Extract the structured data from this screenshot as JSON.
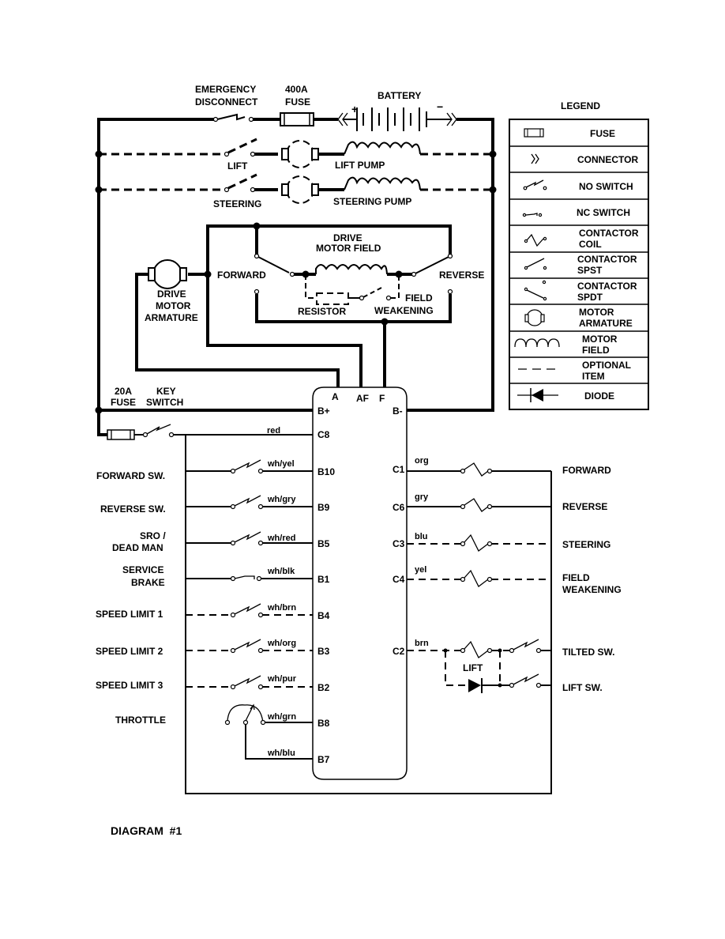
{
  "diagram": {
    "title": "DIAGRAM  #1",
    "power_circuit": {
      "emergency_disconnect": [
        "EMERGENCY",
        "DISCONNECT"
      ],
      "main_fuse": [
        "400A",
        "FUSE"
      ],
      "battery": "BATTERY",
      "battery_plus": "+",
      "battery_minus": "−",
      "lift_switch": "LIFT",
      "lift_pump": "LIFT PUMP",
      "steering_switch": "STEERING",
      "steering_pump": "STEERING PUMP",
      "drive_motor_field": [
        "DRIVE",
        "MOTOR FIELD"
      ],
      "forward": "FORWARD",
      "reverse": "REVERSE",
      "resistor": "RESISTOR",
      "field_weakening": [
        "FIELD",
        "WEAKENING"
      ],
      "drive_motor_armature": [
        "DRIVE",
        "MOTOR",
        "ARMATURE"
      ],
      "key_fuse": [
        "20A",
        "FUSE"
      ],
      "key_switch": [
        "KEY",
        "SWITCH"
      ]
    },
    "controller": {
      "top_terminals": [
        "A",
        "AF",
        "F"
      ],
      "left_pins": [
        {
          "pin": "B+",
          "wire": "",
          "label": []
        },
        {
          "pin": "C8",
          "wire": "red",
          "label": []
        },
        {
          "pin": "B10",
          "wire": "wh/yel",
          "label": [
            "FORWARD SW."
          ]
        },
        {
          "pin": "B9",
          "wire": "wh/gry",
          "label": [
            "REVERSE SW."
          ]
        },
        {
          "pin": "B5",
          "wire": "wh/red",
          "label": [
            "SRO /",
            "DEAD MAN"
          ]
        },
        {
          "pin": "B1",
          "wire": "wh/blk",
          "label": [
            "SERVICE",
            "BRAKE"
          ]
        },
        {
          "pin": "B4",
          "wire": "wh/brn",
          "label": [
            "SPEED LIMIT 1"
          ]
        },
        {
          "pin": "B3",
          "wire": "wh/org",
          "label": [
            "SPEED LIMIT 2"
          ]
        },
        {
          "pin": "B2",
          "wire": "wh/pur",
          "label": [
            "SPEED LIMIT 3"
          ]
        },
        {
          "pin": "B8",
          "wire": "wh/grn",
          "label": [
            "THROTTLE"
          ]
        },
        {
          "pin": "B7",
          "wire": "wh/blu",
          "label": []
        }
      ],
      "right_pins": [
        {
          "pin": "B-",
          "wire": "",
          "label": []
        },
        {
          "pin": "C1",
          "wire": "org",
          "label": [
            "FORWARD"
          ]
        },
        {
          "pin": "C6",
          "wire": "gry",
          "label": [
            "REVERSE"
          ]
        },
        {
          "pin": "C3",
          "wire": "blu",
          "label": [
            "STEERING"
          ]
        },
        {
          "pin": "C4",
          "wire": "yel",
          "label": [
            "FIELD",
            "WEAKENING"
          ]
        },
        {
          "pin": "C2",
          "wire": "brn",
          "label": [
            "TILTED SW.",
            "LIFT SW."
          ]
        }
      ],
      "lift_coil": "LIFT"
    }
  },
  "legend": {
    "title": "LEGEND",
    "items": [
      {
        "symbol": "fuse-icon",
        "label": [
          "FUSE"
        ]
      },
      {
        "symbol": "connector-icon",
        "label": [
          "CONNECTOR"
        ]
      },
      {
        "symbol": "no-switch-icon",
        "label": [
          "NO SWITCH"
        ]
      },
      {
        "symbol": "nc-switch-icon",
        "label": [
          "NC SWITCH"
        ]
      },
      {
        "symbol": "contactor-coil-icon",
        "label": [
          "CONTACTOR",
          "COIL"
        ]
      },
      {
        "symbol": "contactor-spst-icon",
        "label": [
          "CONTACTOR",
          "SPST"
        ]
      },
      {
        "symbol": "contactor-spdt-icon",
        "label": [
          "CONTACTOR",
          "SPDT"
        ]
      },
      {
        "symbol": "motor-armature-icon",
        "label": [
          "MOTOR",
          "ARMATURE"
        ]
      },
      {
        "symbol": "motor-field-icon",
        "label": [
          "MOTOR",
          "FIELD"
        ]
      },
      {
        "symbol": "optional-item-icon",
        "label": [
          "OPTIONAL",
          "ITEM"
        ]
      },
      {
        "symbol": "diode-icon",
        "label": [
          "DIODE"
        ]
      }
    ]
  }
}
